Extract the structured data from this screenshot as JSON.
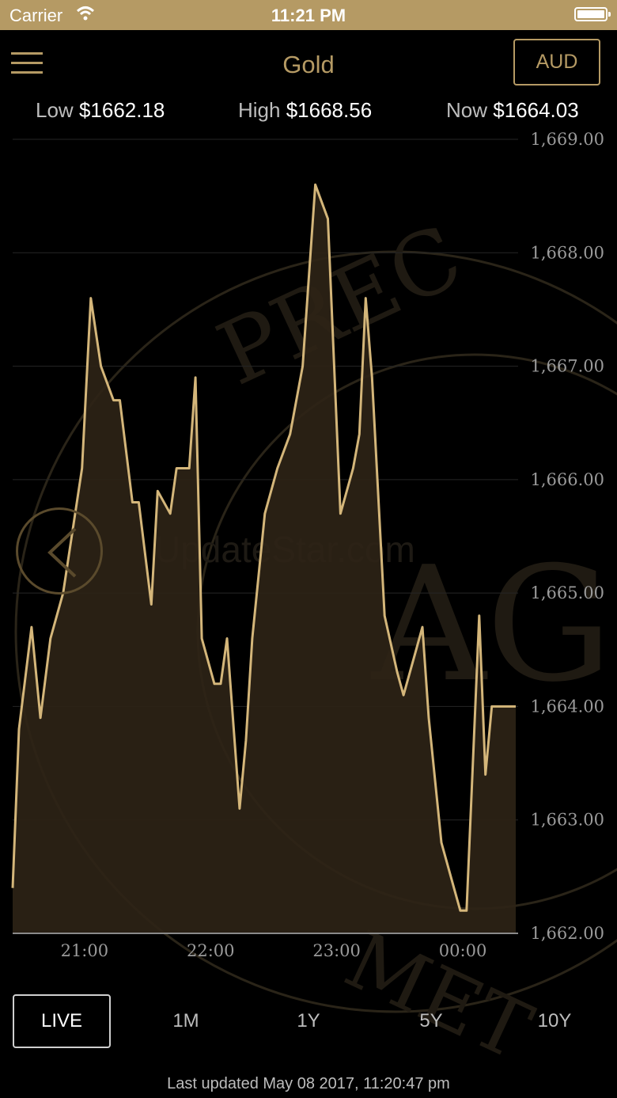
{
  "status_bar": {
    "carrier": "Carrier",
    "time": "11:21 PM"
  },
  "nav": {
    "title": "Gold",
    "currency": "AUD"
  },
  "stats": {
    "low": {
      "label": "Low",
      "value": "$1662.18"
    },
    "high": {
      "label": "High",
      "value": "$1668.56"
    },
    "now": {
      "label": "Now",
      "value": "$1664.03"
    }
  },
  "watermark_text": {
    "top": "PREC",
    "bottom": "MET",
    "monogram": "AG",
    "site": "UpdateStar.com"
  },
  "ranges": [
    {
      "label": "LIVE",
      "active": true
    },
    {
      "label": "1M",
      "active": false
    },
    {
      "label": "1Y",
      "active": false
    },
    {
      "label": "5Y",
      "active": false
    },
    {
      "label": "10Y",
      "active": false
    }
  ],
  "updated": "Last updated May 08 2017, 11:20:47 pm",
  "colors": {
    "accent": "#b59a64",
    "line": "#d4b67a",
    "fill": "#2d2416"
  },
  "chart_data": {
    "type": "area",
    "title": "",
    "xlabel": "",
    "ylabel": "",
    "y_tick_labels": [
      "1,669.00",
      "1,668.00",
      "1,667.00",
      "1,666.00",
      "1,665.00",
      "1,664.00",
      "1,663.00",
      "1,662.00"
    ],
    "y_ticks": [
      1669,
      1668,
      1667,
      1666,
      1665,
      1664,
      1663,
      1662
    ],
    "ylim": [
      1662,
      1669
    ],
    "x_tick_labels": [
      "21:00",
      "22:00",
      "23:00",
      "00:00"
    ],
    "x_ticks": [
      21,
      22,
      23,
      24
    ],
    "xlim": [
      20.43,
      24.42
    ],
    "grid": true,
    "x": [
      20.43,
      20.48,
      20.58,
      20.65,
      20.73,
      20.83,
      20.98,
      21.05,
      21.13,
      21.23,
      21.28,
      21.38,
      21.43,
      21.53,
      21.58,
      21.68,
      21.73,
      21.83,
      21.88,
      21.93,
      22.03,
      22.08,
      22.13,
      22.23,
      22.28,
      22.33,
      22.43,
      22.53,
      22.63,
      22.73,
      22.83,
      22.93,
      23.03,
      23.13,
      23.18,
      23.23,
      23.28,
      23.38,
      23.48,
      23.53,
      23.63,
      23.68,
      23.73,
      23.83,
      23.93,
      23.98,
      24.03,
      24.13,
      24.18,
      24.23,
      24.33,
      24.38,
      24.42
    ],
    "y": [
      1662.4,
      1663.8,
      1664.7,
      1663.9,
      1664.6,
      1665.0,
      1666.1,
      1667.6,
      1667.0,
      1666.7,
      1666.7,
      1665.8,
      1665.8,
      1664.9,
      1665.9,
      1665.7,
      1666.1,
      1666.1,
      1666.9,
      1664.6,
      1664.2,
      1664.2,
      1664.6,
      1663.1,
      1663.7,
      1664.6,
      1665.7,
      1666.1,
      1666.4,
      1667.0,
      1668.6,
      1668.3,
      1665.7,
      1666.1,
      1666.4,
      1667.6,
      1666.9,
      1664.8,
      1664.3,
      1664.1,
      1664.5,
      1664.7,
      1663.9,
      1662.8,
      1662.4,
      1662.2,
      1662.2,
      1664.8,
      1663.4,
      1664.0,
      1664.0,
      1664.0,
      1664.0
    ]
  }
}
